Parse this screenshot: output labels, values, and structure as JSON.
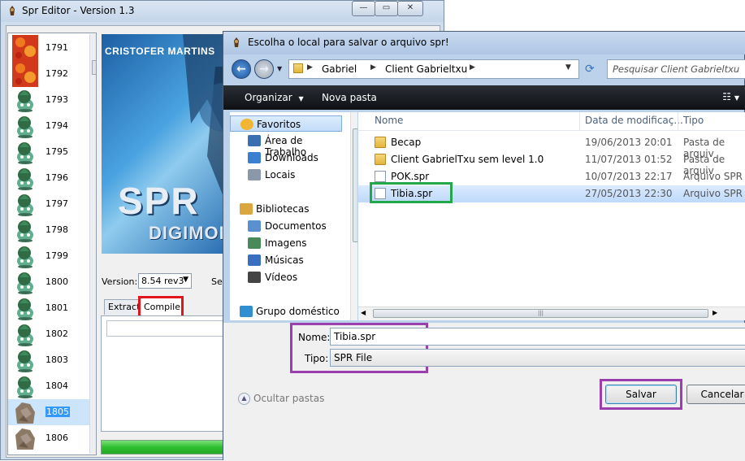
{
  "editor": {
    "title": "Spr Editor - Version 1.3",
    "sprites": [
      {
        "id": "1791",
        "kind": "lava"
      },
      {
        "id": "1792",
        "kind": "lava"
      },
      {
        "id": "1793",
        "kind": "plant"
      },
      {
        "id": "1794",
        "kind": "plant"
      },
      {
        "id": "1795",
        "kind": "plant"
      },
      {
        "id": "1796",
        "kind": "plant"
      },
      {
        "id": "1797",
        "kind": "plant"
      },
      {
        "id": "1798",
        "kind": "plant"
      },
      {
        "id": "1799",
        "kind": "plant"
      },
      {
        "id": "1800",
        "kind": "plant"
      },
      {
        "id": "1801",
        "kind": "plant"
      },
      {
        "id": "1802",
        "kind": "plant"
      },
      {
        "id": "1803",
        "kind": "plant"
      },
      {
        "id": "1804",
        "kind": "plant"
      },
      {
        "id": "1805",
        "kind": "rock"
      },
      {
        "id": "1806",
        "kind": "rock"
      }
    ],
    "selected_sprite": "1805",
    "preview": {
      "top_text": "CRISTOFER MARTINS",
      "big_text": "SPR",
      "sub_text": "DIGIMON"
    },
    "version_label": "Version:",
    "version_value": "8.54 rev3",
    "search_label": "Sea",
    "tabs": [
      {
        "label": "Extract",
        "active": false
      },
      {
        "label": "Compile",
        "active": true
      }
    ],
    "progress": 1.0
  },
  "dialog": {
    "title": "Escolha o local para salvar o arquivo spr!",
    "breadcrumb": [
      "Gabriel",
      "Client Gabrieltxu"
    ],
    "search_placeholder": "Pesquisar Client Gabrieltxu",
    "organize_label": "Organizar",
    "new_folder_label": "Nova pasta",
    "nav": [
      {
        "label": "Favoritos",
        "icon": "star-icon",
        "selected": true,
        "group": true
      },
      {
        "label": "Área de Trabalho",
        "icon": "desktop-icon"
      },
      {
        "label": "Downloads",
        "icon": "downloads-icon"
      },
      {
        "label": "Locais",
        "icon": "places-icon"
      },
      {
        "label": "Bibliotecas",
        "icon": "libraries-icon",
        "group": true
      },
      {
        "label": "Documentos",
        "icon": "documents-icon"
      },
      {
        "label": "Imagens",
        "icon": "images-icon"
      },
      {
        "label": "Músicas",
        "icon": "music-icon"
      },
      {
        "label": "Vídeos",
        "icon": "videos-icon"
      },
      {
        "label": "Grupo doméstico",
        "icon": "homegroup-icon",
        "group": true
      }
    ],
    "columns": [
      "Nome",
      "Data de modificaç...",
      "Tipo"
    ],
    "files": [
      {
        "name": "Becap",
        "date": "19/06/2013 20:01",
        "type": "Pasta de arquiv",
        "kind": "folder"
      },
      {
        "name": "Client GabrielTxu sem level 1.0",
        "date": "11/07/2013 01:52",
        "type": "Pasta de arquiv",
        "kind": "folder"
      },
      {
        "name": "POK.spr",
        "date": "10/07/2013 22:17",
        "type": "Arquivo SPR",
        "kind": "file"
      },
      {
        "name": "Tibia.spr",
        "date": "27/05/2013 22:30",
        "type": "Arquivo SPR",
        "kind": "file",
        "selected": true
      }
    ],
    "name_label": "Nome:",
    "name_value": "Tibia.spr",
    "type_label": "Tipo:",
    "type_value": "SPR File",
    "hide_folders_label": "Ocultar pastas",
    "save_label": "Salvar",
    "cancel_label": "Cancelar"
  },
  "colors": {
    "highlight_red": "#e3151c",
    "highlight_green": "#22a84a",
    "highlight_purple": "#9b3fae",
    "progress_green": "#2fbf2f"
  }
}
